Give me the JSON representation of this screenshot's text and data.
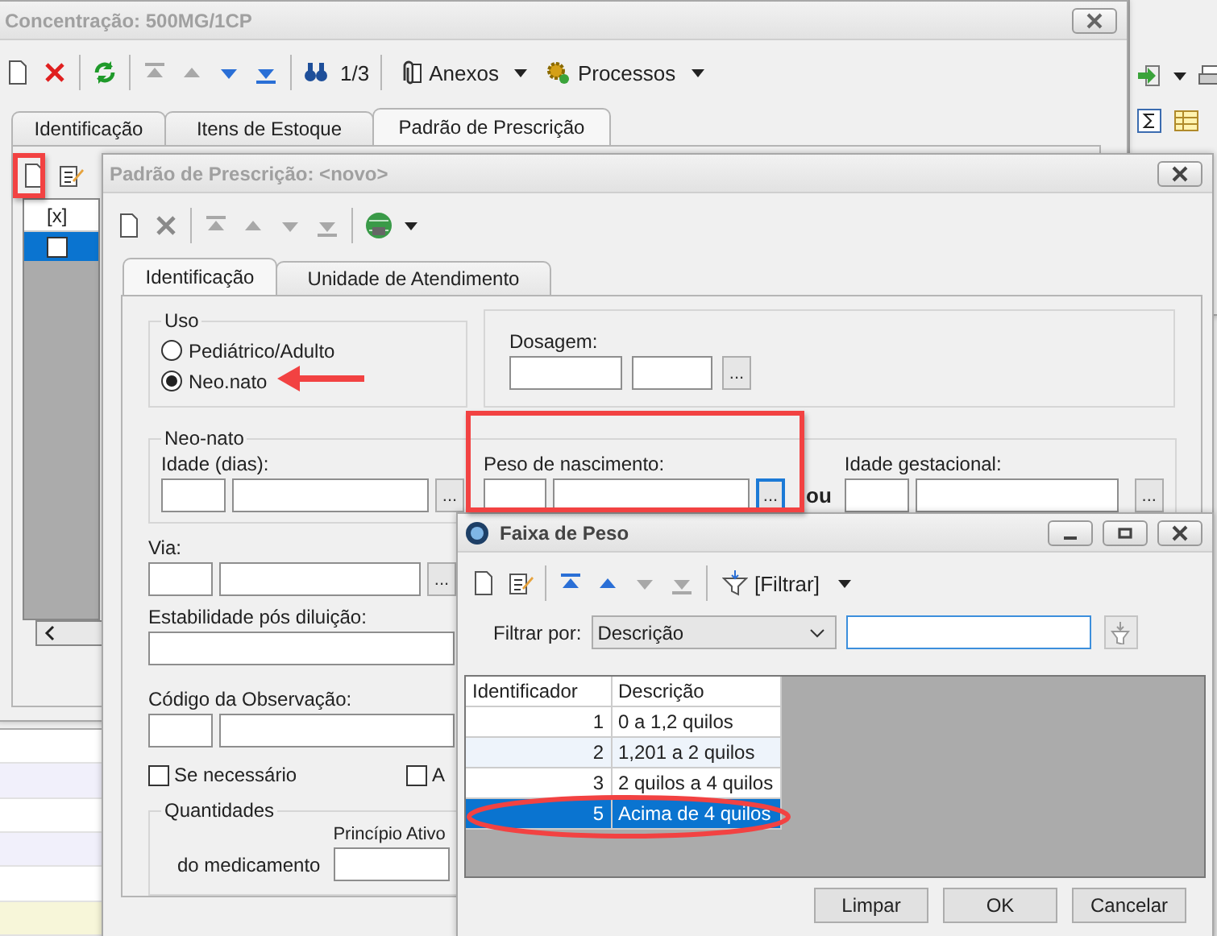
{
  "main_window": {
    "title": "Concentração: 500MG/1CP",
    "record_position": "1/3",
    "menus": [
      "Anexos",
      "Processos"
    ],
    "tabs": [
      {
        "label": "Identificação",
        "selected": false
      },
      {
        "label": "Itens de Estoque",
        "selected": false
      },
      {
        "label": "Padrão de Prescrição",
        "selected": true
      }
    ],
    "grid": {
      "header": "[x]",
      "rows": [
        {
          "checked": false,
          "selected": true
        }
      ]
    }
  },
  "prescription_window": {
    "title": "Padrão de Prescrição: <novo>",
    "tabs": [
      {
        "label": "Identificação",
        "selected": true
      },
      {
        "label": "Unidade de Atendimento",
        "selected": false
      }
    ],
    "uso": {
      "legend": "Uso",
      "options": [
        {
          "label": "Pediátrico/Adulto",
          "selected": false
        },
        {
          "label": "Neo.nato",
          "selected": true
        }
      ]
    },
    "dosagem": {
      "label": "Dosagem:",
      "button": "..."
    },
    "neonato": {
      "legend": "Neo-nato",
      "idade_label": "Idade (dias):",
      "idade_button": "...",
      "peso_label": "Peso de nascimento:",
      "peso_button": "...",
      "or": "ou",
      "gestacional_label": "Idade gestacional:",
      "gestacional_button": "..."
    },
    "via": {
      "label": "Via:",
      "button": "..."
    },
    "estabilidade_label": "Estabilidade pós diluição:",
    "codigo_label": "Código da Observação:",
    "checkboxes": [
      {
        "label": "Se necessário",
        "checked": false
      },
      {
        "label": "A",
        "checked": false
      }
    ],
    "quantidades": {
      "legend": "Quantidades",
      "row_label": "do medicamento",
      "principio_label": "Princípio Ativo"
    }
  },
  "weight_window": {
    "title": "Faixa de Peso",
    "filter_button": "[Filtrar]",
    "filter_label": "Filtrar por:",
    "filter_field": "Descrição",
    "columns": [
      "Identificador",
      "Descrição"
    ],
    "rows": [
      {
        "id": "1",
        "description": "0 a 1,2 quilos",
        "selected": false
      },
      {
        "id": "2",
        "description": "1,201 a 2 quilos",
        "selected": false
      },
      {
        "id": "3",
        "description": "2 quilos a 4 quilos",
        "selected": false
      },
      {
        "id": "5",
        "description": "Acima de 4 quilos",
        "selected": true
      }
    ],
    "buttons": [
      "Limpar",
      "OK",
      "Cancelar"
    ]
  }
}
